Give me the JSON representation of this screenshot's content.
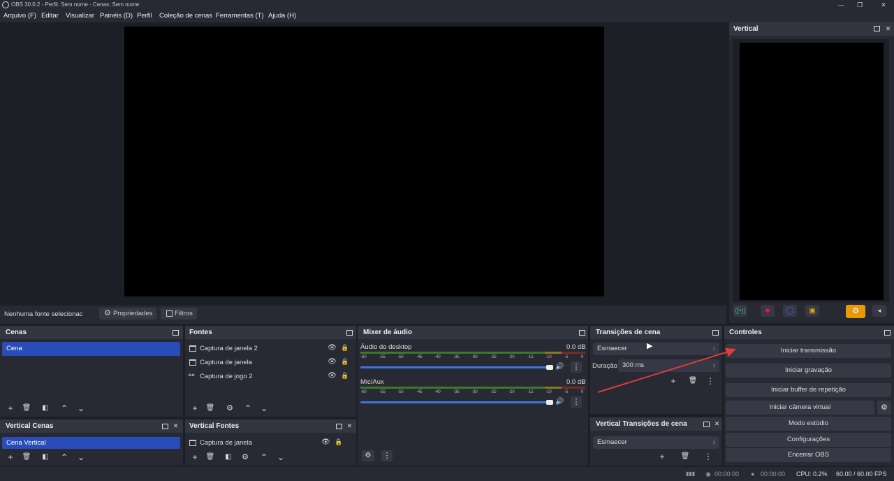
{
  "window": {
    "title": "OBS 30.0.2 - Perfil: Sem nome - Cenas: Sem nome",
    "minimize": "—",
    "maximize": "❐",
    "close": "✕"
  },
  "menu": [
    "Arquivo (F)",
    "Editar",
    "Visualizar",
    "Painéis (D)",
    "Perfil",
    "Coleção de cenas",
    "Ferramentas (T)",
    "Ajuda (H)"
  ],
  "source_toolbar": {
    "status": "Nenhuma fonte selecionac",
    "properties": "Propriedades",
    "filters": "Filtros"
  },
  "vertical": {
    "title": "Vertical"
  },
  "scenes": {
    "title": "Cenas",
    "items": [
      "Cena"
    ]
  },
  "sources": {
    "title": "Fontes",
    "items": [
      "Captura de janela 2",
      "Captura de janela",
      "Captura de jogo 2"
    ]
  },
  "mixer": {
    "title": "Mixer de áudio",
    "channels": [
      {
        "name": "Áudio do desktop",
        "level": "0.0 dB",
        "volume": 1.0
      },
      {
        "name": "Mic/Aux",
        "level": "0.0 dB",
        "volume": 1.0
      }
    ],
    "ticks": [
      "-60",
      "-55",
      "-50",
      "-45",
      "-40",
      "-35",
      "-30",
      "-25",
      "-20",
      "-15",
      "-10",
      "-5",
      "0"
    ]
  },
  "transitions": {
    "title": "Transições de cena",
    "selected": "Esmaecer",
    "duration_label": "Duração",
    "duration_value": "300 ms"
  },
  "controls": {
    "title": "Controles",
    "start_stream": "Iniciar transmissão",
    "start_record": "Iniciar gravação",
    "replay_buffer": "Iniciar buffer de repetição",
    "virtual_cam": "Iniciar câmera virtual",
    "studio_mode": "Modo estúdio",
    "settings": "Configurações",
    "exit": "Encerrar OBS"
  },
  "vertical_scenes": {
    "title": "Vertical Cenas",
    "items": [
      "Cena Vertical"
    ]
  },
  "vertical_sources": {
    "title": "Vertical Fontes",
    "items": [
      "Captura de janela"
    ]
  },
  "vertical_transitions": {
    "title": "Vertical Transições de cena",
    "selected": "Esmaecer"
  },
  "status": {
    "stream_time": "00:00:00",
    "record_time": "00:00:00",
    "cpu": "CPU: 0.2%",
    "fps": "60.00 / 60.00 FPS"
  },
  "colors": {
    "selected": "#284cb8",
    "accent_orange": "#e69a0a",
    "arrow": "#e03c3c"
  }
}
